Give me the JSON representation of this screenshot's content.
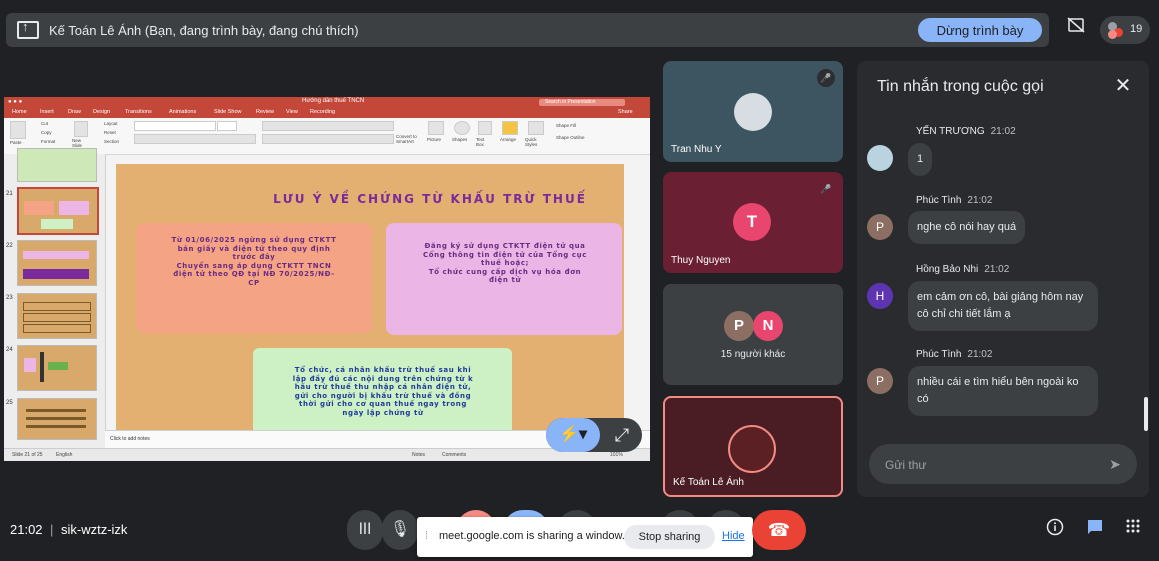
{
  "presenting_bar": {
    "title": "Kế Toán Lê Ánh (Bạn, đang trình bày, đang chú thích)",
    "stop_button": "Dừng trình bày",
    "participant_count": "19"
  },
  "powerpoint": {
    "file_name": "Hướng dẫn thuế TNCN",
    "search_placeholder": "Search in Presentation",
    "tabs": [
      "Home",
      "Insert",
      "Draw",
      "Design",
      "Transitions",
      "Animations",
      "Slide Show",
      "Review",
      "View",
      "Recording"
    ],
    "share_label": "Share",
    "ribbon": {
      "paste": "Paste",
      "cut": "Cut",
      "copy": "Copy",
      "format": "Format",
      "new_slide": "New Slide",
      "layout": "Layout",
      "reset": "Reset",
      "section": "Section",
      "picture": "Picture",
      "shapes": "Shapes",
      "text_box": "Text Box",
      "arrange": "Arrange",
      "quick_styles": "Quick Styles",
      "shape_fill": "Shape Fill",
      "shape_outline": "Shape Outline",
      "convert": "Convert to SmartArt"
    },
    "thumbnail_numbers": [
      "21",
      "22",
      "23",
      "24",
      "25"
    ],
    "slide": {
      "title": "LƯU Ý VỀ CHỨNG TỪ KHẤU TRỪ THUẾ",
      "box1": "Từ 01/06/2025 ngừng sử dụng CTKTT\nbản giấy và điện tử theo quy định\ntrước đây\nChuyển sang áp dụng CTKTT TNCN\nđiện tử theo QĐ tại NĐ 70/2025/NĐ-\nCP",
      "box2": "Đăng ký sử dụng CTKTT điện tử qua\nCổng thông tin điện tử của Tổng cục\nthuế hoặc;\nTổ chức cung cấp dịch vụ hóa đơn\nđiện tử",
      "box3": "Tổ chức, cá nhân khấu trừ thuế sau khi\nlập đầy đủ các nội dung trên chứng từ k\nhấu trừ thuế thu nhập cá nhân điện tử,\ngửi cho người bị khấu trừ thuế và đồng\nthời gửi cho cơ quan thuế ngay trong\nngày lập chứng từ"
    },
    "notes_placeholder": "Click to add notes",
    "status": {
      "slide_of": "Slide 21 of 25",
      "language": "English",
      "notes": "Notes",
      "comments": "Comments",
      "zoom": "101%"
    }
  },
  "participants": [
    {
      "name": "Tran Nhu Y",
      "muted": true
    },
    {
      "name": "Thuy Nguyen",
      "initial": "T",
      "muted": true
    },
    {
      "name": "15 người khác",
      "initials": [
        "P",
        "N"
      ]
    },
    {
      "name": "Kế Toán Lê Ánh"
    }
  ],
  "chat": {
    "title": "Tin nhắn trong cuộc gọi",
    "messages": [
      {
        "sender": "YẾN TRƯƠNG",
        "time": "21:02",
        "text": "1"
      },
      {
        "sender": "Phúc Tình",
        "time": "21:02",
        "text": "nghe cô nói hay quá",
        "initial": "P"
      },
      {
        "sender": "Hồng Bảo Nhi",
        "time": "21:02",
        "text": "em cảm ơn cô, bài giảng hôm nay\ncô chỉ chi tiết lắm ạ",
        "initial": "H"
      },
      {
        "sender": "Phúc Tình",
        "time": "21:02",
        "text": "nhiều cái e tìm hiểu bên ngoài ko\ncó",
        "initial": "P"
      }
    ],
    "input_placeholder": "Gửi thư"
  },
  "bottom_bar": {
    "time": "21:02",
    "separator": "|",
    "meeting_code": "sik-wztz-izk"
  },
  "share_banner": {
    "message": "meet.google.com is sharing a window.",
    "stop_sharing": "Stop sharing",
    "hide": "Hide"
  },
  "colors": {
    "accent": "#8ab4f8",
    "end_call": "#ea4335",
    "slide_title": "#7a2a9a",
    "chat_avatar_p": "#8d6e63",
    "chat_avatar_h": "#5e35b1"
  }
}
